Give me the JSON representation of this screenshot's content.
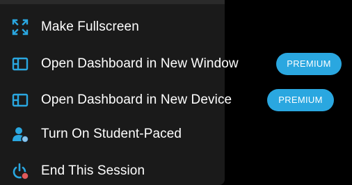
{
  "menu": {
    "items": [
      {
        "id": "fullscreen",
        "label": "Make Fullscreen",
        "icon": "expand-icon"
      },
      {
        "id": "new-window",
        "label": "Open Dashboard in New Window",
        "icon": "dashboard-layout-icon",
        "badge": "PREMIUM"
      },
      {
        "id": "new-device",
        "label": "Open Dashboard in New Device",
        "icon": "dashboard-layout-icon",
        "badge": "PREMIUM"
      },
      {
        "id": "student-paced",
        "label": "Turn On Student-Paced",
        "icon": "user-icon"
      },
      {
        "id": "end-session",
        "label": "End This Session",
        "icon": "power-icon"
      }
    ]
  },
  "colors": {
    "menu_background": "#1a1a1a",
    "icon_accent": "#2aa7e0",
    "badge_background": "#2aa7e0",
    "status_dot_blue": "#4a9fd8",
    "status_dot_red": "#e05a5a",
    "text": "#ffffff"
  }
}
